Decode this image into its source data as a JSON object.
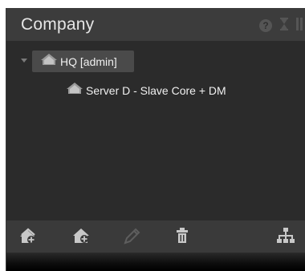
{
  "panel": {
    "title": "Company"
  },
  "tree": {
    "root": {
      "label": "HQ [admin]",
      "icon": "house-icon",
      "expanded": true
    },
    "children": [
      {
        "label": "Server D - Slave Core + DM",
        "icon": "house-icon"
      }
    ]
  },
  "header_icons": [
    "help-icon",
    "hourglass-icon",
    "pause-icon"
  ],
  "toolbar": {
    "icons": [
      "add-site-icon",
      "add-child-site-icon",
      "edit-icon",
      "delete-icon",
      "hierarchy-icon"
    ]
  },
  "colors": {
    "panel_bg": "#2b2b2b",
    "header_bg": "#3c3c3c",
    "selection_bg": "#4a4a4a",
    "icon_light": "#c8c8c8",
    "icon_dim": "#5a5a5a"
  }
}
